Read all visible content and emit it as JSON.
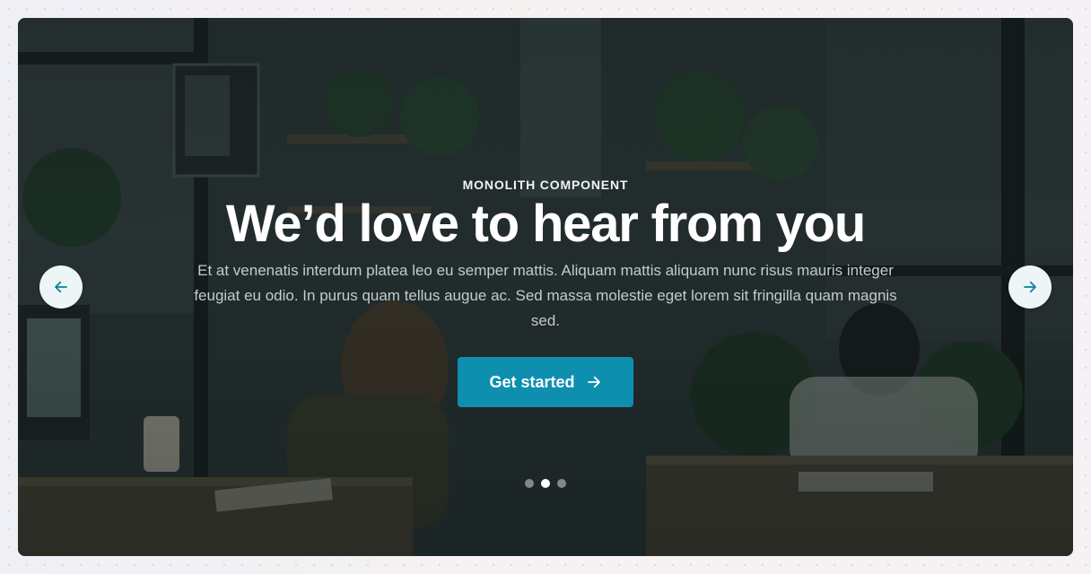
{
  "hero": {
    "eyebrow": "MONOLITH COMPONENT",
    "title": "We’d love to hear from you",
    "description": "Et at venenatis interdum platea leo eu semper mattis. Aliquam mattis aliquam nunc risus mauris integer feugiat eu odio. In purus quam tellus augue ac. Sed massa molestie eget lorem sit fringilla quam magnis sed.",
    "cta_label": "Get started",
    "cta_icon": "arrow-right-icon",
    "background_image": "office-workspace-photo"
  },
  "carousel": {
    "prev_icon": "arrow-left-icon",
    "next_icon": "arrow-right-icon",
    "slide_count": 3,
    "active_slide": 2
  },
  "colors": {
    "accent": "#0e8fb0",
    "nav_button_bg": "#eef5f7",
    "nav_icon": "#0e7f99",
    "overlay": "#1e2626"
  }
}
